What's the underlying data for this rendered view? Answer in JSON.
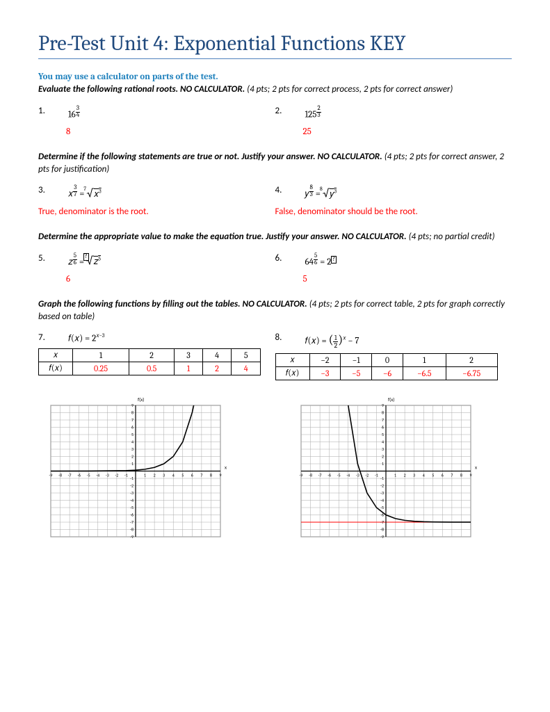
{
  "title": "Pre-Test Unit 4: Exponential Functions KEY",
  "subheader": "You may use a calculator on parts of the test.",
  "sec1": {
    "instr_b": "Evaluate the following rational roots. NO CALCULATOR.",
    "instr_i": "  (4 pts; 2 pts for correct process, 2 pts for correct answer)",
    "q1": {
      "num": "1.",
      "base": "16",
      "fn": "3",
      "fd": "4",
      "ans": "8"
    },
    "q2": {
      "num": "2.",
      "base": "125",
      "fn": "2",
      "fd": "3",
      "ans": "25"
    }
  },
  "sec2": {
    "instr_b": "Determine if the following statements are true or not.  Justify your answer. NO CALCULATOR.",
    "instr_i": "  (4 pts; 2 pts for correct answer, 2 pts for justification)",
    "q3": {
      "num": "3.",
      "var": "𝑥",
      "fn": "3",
      "fd": "7",
      "ridx": "7",
      "rexp": "3",
      "ans": "True, denominator is the root."
    },
    "q4": {
      "num": "4.",
      "var": "𝑦",
      "fn": "8",
      "fd": "3",
      "ridx": "8",
      "rexp": "3",
      "ans": "False, denominator should be the root."
    }
  },
  "sec3": {
    "instr_b": "Determine the appropriate value to make the equation true. Justify your answer. NO CALCULATOR.",
    "instr_i": "  (4 pts; no partial credit)",
    "q5": {
      "num": "5.",
      "var": "𝑧",
      "fn": "5",
      "fd": "6",
      "rexp": "5",
      "ans": "6"
    },
    "q6": {
      "num": "6.",
      "base": "64",
      "fn": "5",
      "fd": "6",
      "rbase": "2",
      "ans": "5"
    }
  },
  "sec4": {
    "instr_b": "Graph the following functions by filling out the tables. NO CALCULATOR.",
    "instr_i": "  (4 pts; 2 pts for correct table, 2 pts for graph correctly based on table)",
    "q7": {
      "num": "7.",
      "expr": "𝑓(𝑥) = 2",
      "sup": "𝑥−3",
      "xlabel": "𝑥",
      "flabel": "𝑓(𝑥)",
      "x": [
        "1",
        "2",
        "3",
        "4",
        "5"
      ],
      "f": [
        "0.25",
        "0.5",
        "1",
        "2",
        "4"
      ]
    },
    "q8": {
      "num": "8.",
      "expr_pre": "𝑓(𝑥) = ",
      "fn": "1",
      "fd": "2",
      "expr_post": " − 7",
      "sup": "𝑥",
      "xlabel": "𝑥",
      "flabel": "𝑓(𝑥)",
      "x": [
        "−2",
        "−1",
        "0",
        "1",
        "2"
      ],
      "f": [
        "−3",
        "−5",
        "−6",
        "−6.5",
        "−6.75"
      ]
    }
  },
  "chart_data": [
    {
      "type": "line",
      "title": "",
      "xlabel": "x",
      "ylabel": "f(x)",
      "xlim": [
        -9,
        9
      ],
      "ylim": [
        -9,
        9
      ],
      "x_ticks": [
        -9,
        -8,
        -7,
        -6,
        -5,
        -4,
        -3,
        -2,
        -1,
        0,
        1,
        2,
        3,
        4,
        5,
        6,
        7,
        8,
        9
      ],
      "y_ticks": [
        -9,
        -8,
        -7,
        -6,
        -5,
        -4,
        -3,
        -2,
        -1,
        1,
        2,
        3,
        4,
        5,
        6,
        7,
        8,
        9
      ],
      "asymptote_y": 0,
      "series": [
        {
          "name": "f(x)=2^(x-3)",
          "x": [
            -9,
            -5,
            -1,
            0,
            1,
            2,
            3,
            4,
            5,
            6,
            6.17
          ],
          "values": [
            0.0002,
            0.004,
            0.0625,
            0.125,
            0.25,
            0.5,
            1,
            2,
            4,
            8,
            9
          ]
        }
      ]
    },
    {
      "type": "line",
      "title": "",
      "xlabel": "x",
      "ylabel": "f(x)",
      "xlim": [
        -9,
        9
      ],
      "ylim": [
        -9,
        9
      ],
      "x_ticks": [
        -9,
        -8,
        -7,
        -6,
        -5,
        -4,
        -3,
        -2,
        -1,
        0,
        1,
        2,
        3,
        4,
        5,
        6,
        7,
        8,
        9
      ],
      "y_ticks": [
        -9,
        -8,
        -7,
        -6,
        -5,
        -4,
        -3,
        -2,
        -1,
        1,
        2,
        3,
        4,
        5,
        6,
        7,
        8,
        9
      ],
      "asymptote_y": -7,
      "series": [
        {
          "name": "f(x)=(1/2)^x - 7",
          "x": [
            -4,
            -3,
            -2,
            -1,
            0,
            1,
            2,
            3,
            4,
            5,
            6,
            7,
            8,
            9
          ],
          "values": [
            9,
            1,
            -3,
            -5,
            -6,
            -6.5,
            -6.75,
            -6.875,
            -6.9375,
            -6.969,
            -6.984,
            -6.992,
            -6.996,
            -6.998
          ]
        }
      ]
    }
  ]
}
